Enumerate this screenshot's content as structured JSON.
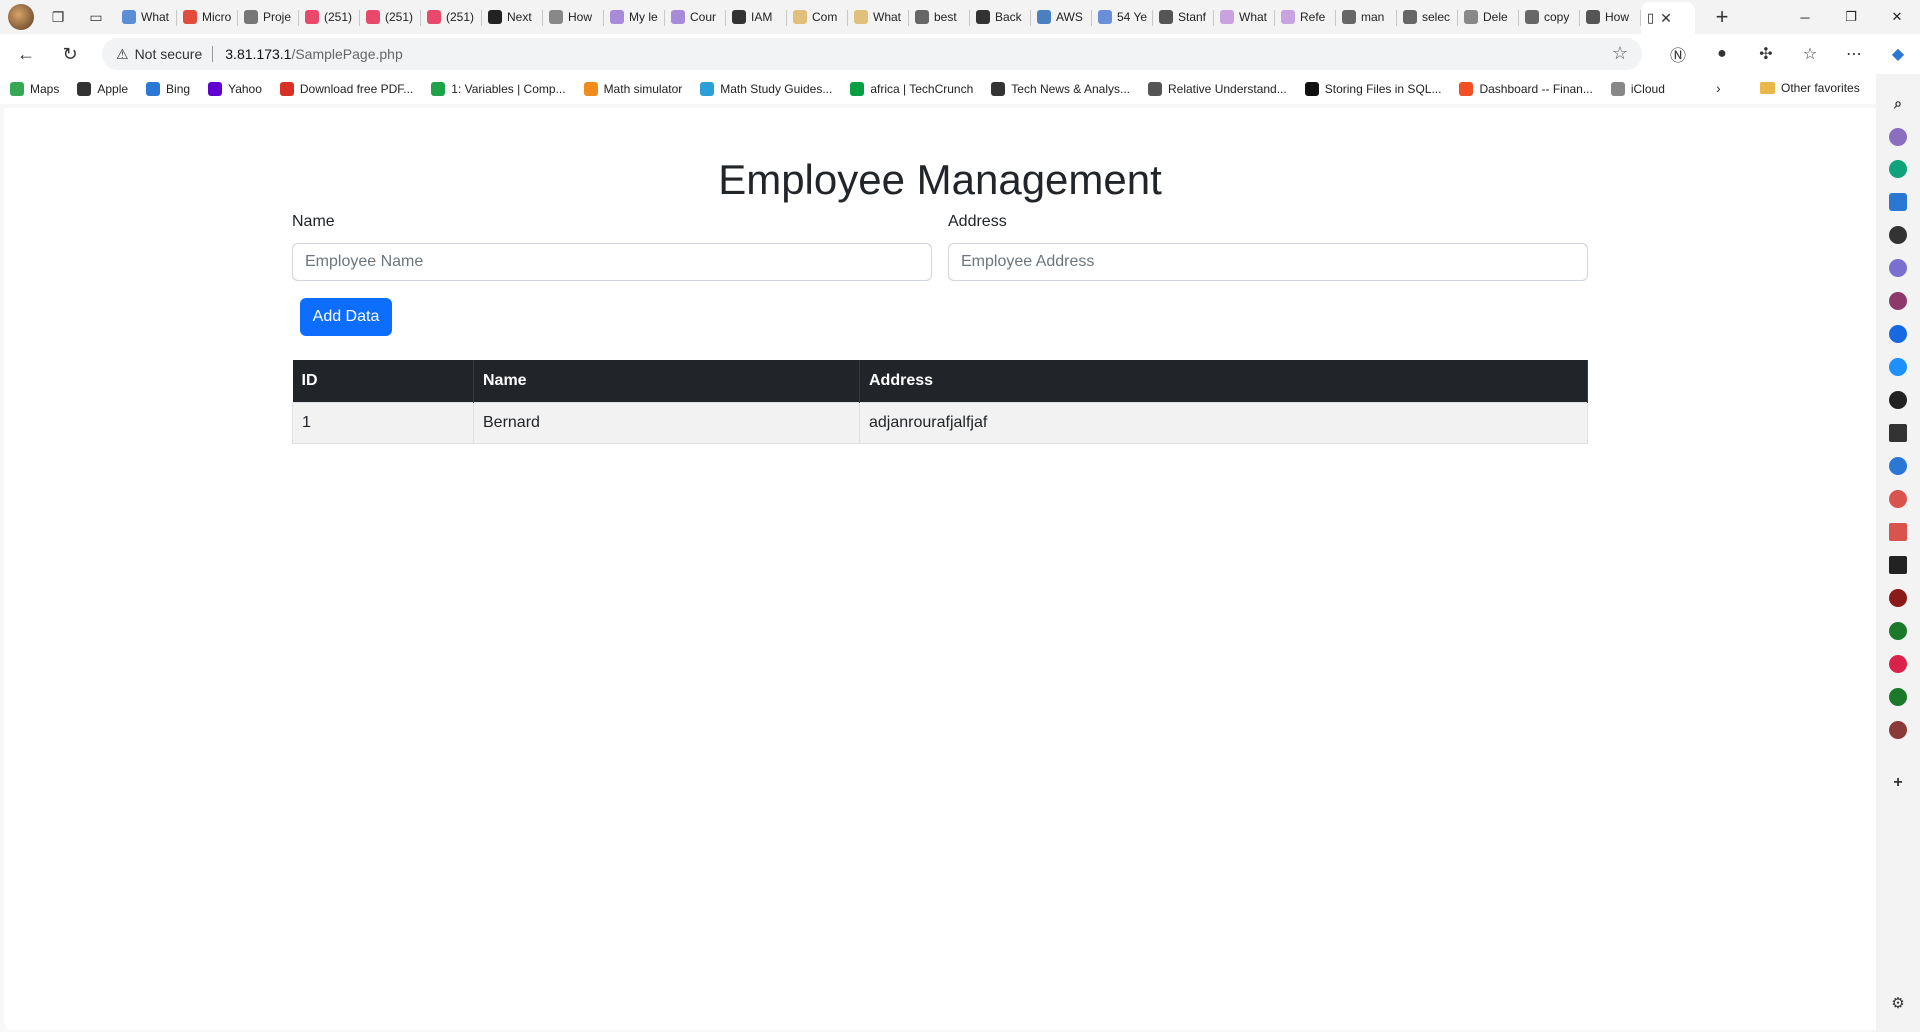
{
  "browser": {
    "tabs": [
      {
        "label": "What",
        "color": "#5a8fd6"
      },
      {
        "label": "Micro",
        "color": "#e24c3d"
      },
      {
        "label": "Proje",
        "color": "#777777"
      },
      {
        "label": "(251)",
        "color": "#e8496b"
      },
      {
        "label": "(251)",
        "color": "#e8496b"
      },
      {
        "label": "(251)",
        "color": "#e8496b"
      },
      {
        "label": "Next",
        "color": "#222222"
      },
      {
        "label": "How",
        "color": "#888888"
      },
      {
        "label": "My le",
        "color": "#a78bd8"
      },
      {
        "label": "Cour",
        "color": "#a78bd8"
      },
      {
        "label": "IAM",
        "color": "#333333"
      },
      {
        "label": "Com",
        "color": "#e0c07a"
      },
      {
        "label": "What",
        "color": "#e0c07a"
      },
      {
        "label": "best",
        "color": "#666666"
      },
      {
        "label": "Back",
        "color": "#333333"
      },
      {
        "label": "AWS",
        "color": "#4a7fc0"
      },
      {
        "label": "54 Ye",
        "color": "#6a8fd8"
      },
      {
        "label": "Stanf",
        "color": "#555555"
      },
      {
        "label": "What",
        "color": "#c9a3e0"
      },
      {
        "label": "Refe",
        "color": "#c9a3e0"
      },
      {
        "label": "man",
        "color": "#666666"
      },
      {
        "label": "selec",
        "color": "#666666"
      },
      {
        "label": "Dele",
        "color": "#888888"
      },
      {
        "label": "copy",
        "color": "#666666"
      },
      {
        "label": "How",
        "color": "#555555"
      }
    ],
    "active_tab_icon": "page-icon",
    "address": {
      "security_label": "Not secure",
      "host": "3.81.173.1",
      "path": "/SamplePage.php"
    },
    "bookmarks": [
      {
        "label": "Maps",
        "color": "#34a853"
      },
      {
        "label": "Apple",
        "color": "#333333"
      },
      {
        "label": "Bing",
        "color": "#2b78d4"
      },
      {
        "label": "Yahoo",
        "color": "#6001d2"
      },
      {
        "label": "Download free PDF...",
        "color": "#d93025"
      },
      {
        "label": "1: Variables | Comp...",
        "color": "#1fa34a"
      },
      {
        "label": "Math simulator",
        "color": "#f08c1e"
      },
      {
        "label": "Math Study Guides...",
        "color": "#2b9fd8"
      },
      {
        "label": "africa | TechCrunch",
        "color": "#0a9e42"
      },
      {
        "label": "Tech News & Analys...",
        "color": "#333333"
      },
      {
        "label": "Relative Understand...",
        "color": "#555555"
      },
      {
        "label": "Storing Files in SQL...",
        "color": "#111111"
      },
      {
        "label": "Dashboard -- Finan...",
        "color": "#f25022"
      },
      {
        "label": "iCloud",
        "color": "#888888"
      }
    ],
    "other_favorites": "Other favorites"
  },
  "page": {
    "title": "Employee Management",
    "form": {
      "name_label": "Name",
      "name_placeholder": "Employee Name",
      "address_label": "Address",
      "address_placeholder": "Employee Address",
      "submit_label": "Add Data"
    },
    "table": {
      "headers": [
        "ID",
        "Name",
        "Address"
      ],
      "rows": [
        [
          "1",
          "Bernard",
          "adjanrourafjalfjaf"
        ]
      ]
    }
  },
  "colors": {
    "primary_button": "#0d6efd",
    "table_header_bg": "#212529",
    "table_row_bg": "#f2f2f2"
  }
}
